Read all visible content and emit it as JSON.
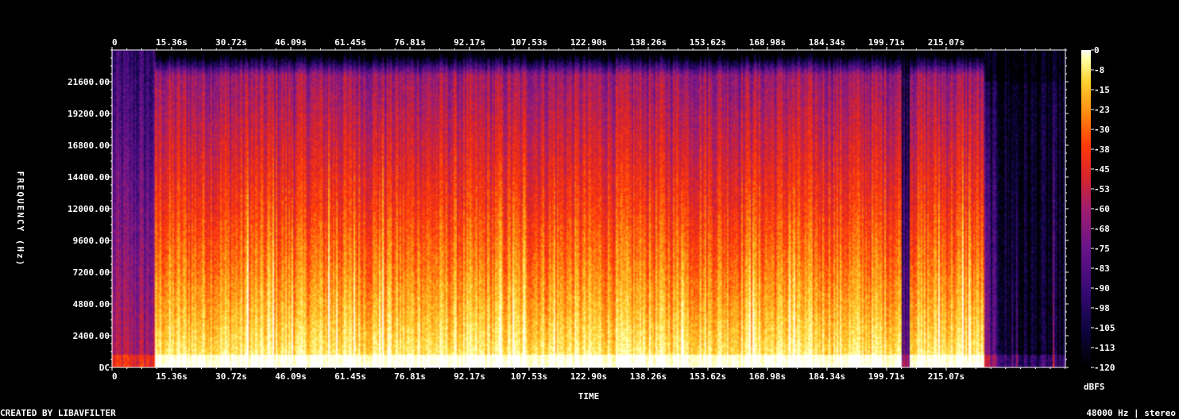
{
  "footer": {
    "credit": "CREATED BY LIBAVFILTER",
    "format": "48000 Hz | stereo"
  },
  "chart_data": {
    "type": "heatmap",
    "title": "",
    "xlabel": "TIME",
    "ylabel": "FREQUENCY (Hz)",
    "colorbar_label": "dBFS",
    "x_ticks": [
      "0",
      "15.36s",
      "30.72s",
      "46.09s",
      "61.45s",
      "76.81s",
      "92.17s",
      "107.53s",
      "122.90s",
      "138.26s",
      "153.62s",
      "168.98s",
      "184.34s",
      "199.71s",
      "215.07s"
    ],
    "x_tick_values": [
      0,
      15.36,
      30.72,
      46.09,
      61.45,
      76.81,
      92.17,
      107.53,
      122.9,
      138.26,
      153.62,
      168.98,
      184.34,
      199.71,
      215.07
    ],
    "xlim": [
      0,
      245.8
    ],
    "y_ticks": [
      "DC",
      "2400.00",
      "4800.00",
      "7200.00",
      "9600.00",
      "12000.00",
      "14400.00",
      "16800.00",
      "19200.00",
      "21600.00"
    ],
    "y_tick_values": [
      0,
      2400,
      4800,
      7200,
      9600,
      12000,
      14400,
      16800,
      19200,
      21600
    ],
    "ylim": [
      0,
      24000
    ],
    "colorbar_ticks": [
      "0",
      "-8",
      "-15",
      "-23",
      "-30",
      "-38",
      "-45",
      "-53",
      "-60",
      "-68",
      "-75",
      "-83",
      "-90",
      "-98",
      "-105",
      "-113",
      "-120"
    ],
    "colorbar_values": [
      0,
      -7.5,
      -15,
      -22.5,
      -30,
      -37.5,
      -45,
      -52.5,
      -60,
      -67.5,
      -75,
      -82.5,
      -90,
      -97.5,
      -105,
      -112.5,
      -120
    ],
    "colorbar_range": [
      -120,
      0
    ],
    "colormap": [
      "#000000",
      "#0d0540",
      "#3a0a78",
      "#6a148a",
      "#a01e6e",
      "#d8242c",
      "#ff3a0a",
      "#ff8a10",
      "#ffd030",
      "#ffffa0",
      "#ffffff"
    ],
    "audio_start": 11,
    "audio_end": 225,
    "silence_region": [
      203.5,
      205.5
    ]
  }
}
